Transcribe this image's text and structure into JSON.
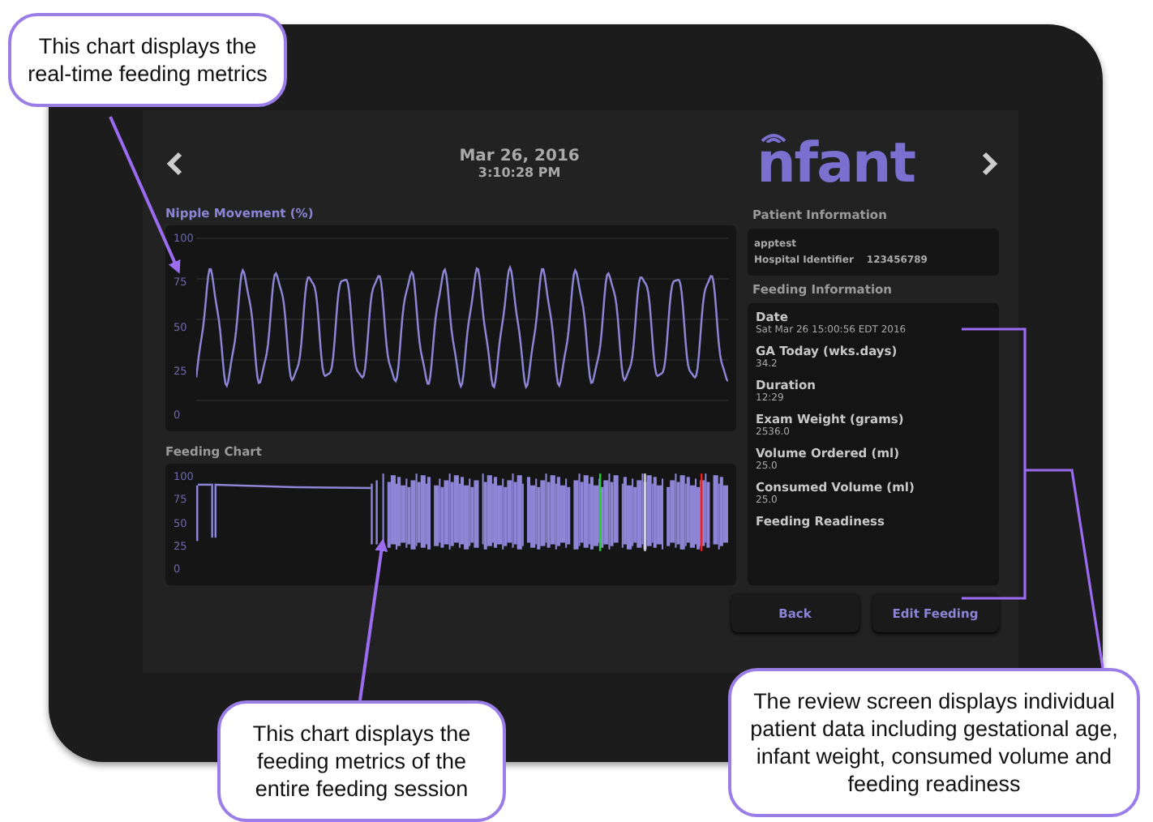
{
  "screen": {
    "date": "Mar 26, 2016",
    "time": "3:10:28 PM",
    "logo": "nfant"
  },
  "nipple_chart": {
    "title": "Nipple Movement (%)",
    "y_tick_labels": [
      "100",
      "75",
      "50",
      "25",
      "0"
    ]
  },
  "feeding_chart": {
    "title": "Feeding Chart",
    "y_tick_labels": [
      "100",
      "75",
      "50",
      "25",
      "0"
    ]
  },
  "patient_information": {
    "title": "Patient Information",
    "name": "apptest",
    "identifier_label": "Hospital Identifier",
    "identifier": "123456789"
  },
  "feeding_information": {
    "title": "Feeding Information",
    "items": [
      {
        "label": "Date",
        "value": "Sat Mar 26 15:00:56 EDT 2016"
      },
      {
        "label": "GA Today (wks.days)",
        "value": "34.2"
      },
      {
        "label": "Duration",
        "value": "12:29"
      },
      {
        "label": "Exam Weight (grams)",
        "value": "2536.0"
      },
      {
        "label": "Volume Ordered (ml)",
        "value": "25.0"
      },
      {
        "label": "Consumed Volume (ml)",
        "value": "25.0"
      },
      {
        "label": "Feeding Readiness"
      }
    ]
  },
  "buttons": [
    "Back",
    "Edit Feeding"
  ],
  "callouts": [
    {
      "text": "This chart displays the real-time feeding metrics"
    },
    {
      "text": "This chart displays the feeding metrics of the entire feeding session"
    },
    {
      "text": "The review screen displays individual patient data including gestational age, infant weight, consumed volume and feeding readiness"
    }
  ]
}
